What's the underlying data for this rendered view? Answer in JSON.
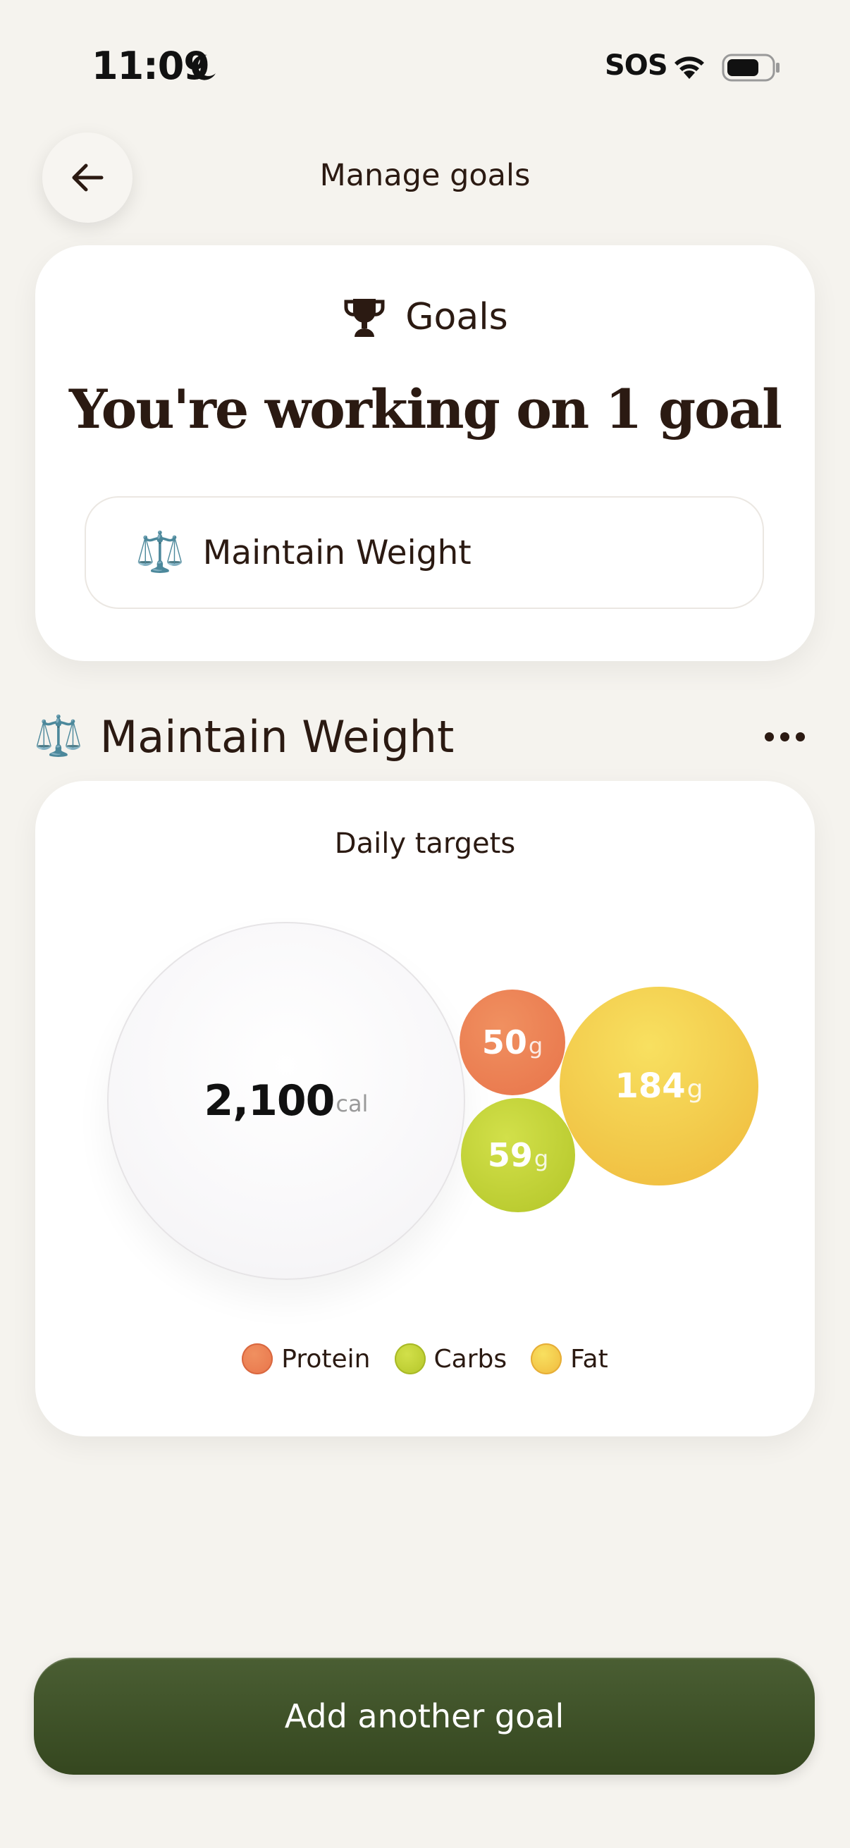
{
  "status_bar": {
    "time": "11:09",
    "carrier": "SOS"
  },
  "nav": {
    "title": "Manage goals"
  },
  "goals_card": {
    "header_label": "Goals",
    "headline": "You're working on 1 goal",
    "goals": [
      {
        "emoji": "⚖️",
        "label": "Maintain Weight"
      }
    ]
  },
  "section": {
    "emoji": "⚖️",
    "title": "Maintain Weight"
  },
  "targets": {
    "title": "Daily targets",
    "calories": {
      "value": "2,100",
      "unit": "cal"
    },
    "protein": {
      "value": "50",
      "unit": "g"
    },
    "carbs": {
      "value": "59",
      "unit": "g"
    },
    "fat": {
      "value": "184",
      "unit": "g"
    },
    "legend": [
      {
        "label": "Protein",
        "color": "#e8774c"
      },
      {
        "label": "Carbs",
        "color": "#bfd032"
      },
      {
        "label": "Fat",
        "color": "#f4c94c"
      }
    ]
  },
  "colors": {
    "background": "#f5f3ee",
    "primary_button": "#3f522a",
    "text": "#2b1a12"
  },
  "actions": {
    "add_goal_label": "Add another goal"
  }
}
